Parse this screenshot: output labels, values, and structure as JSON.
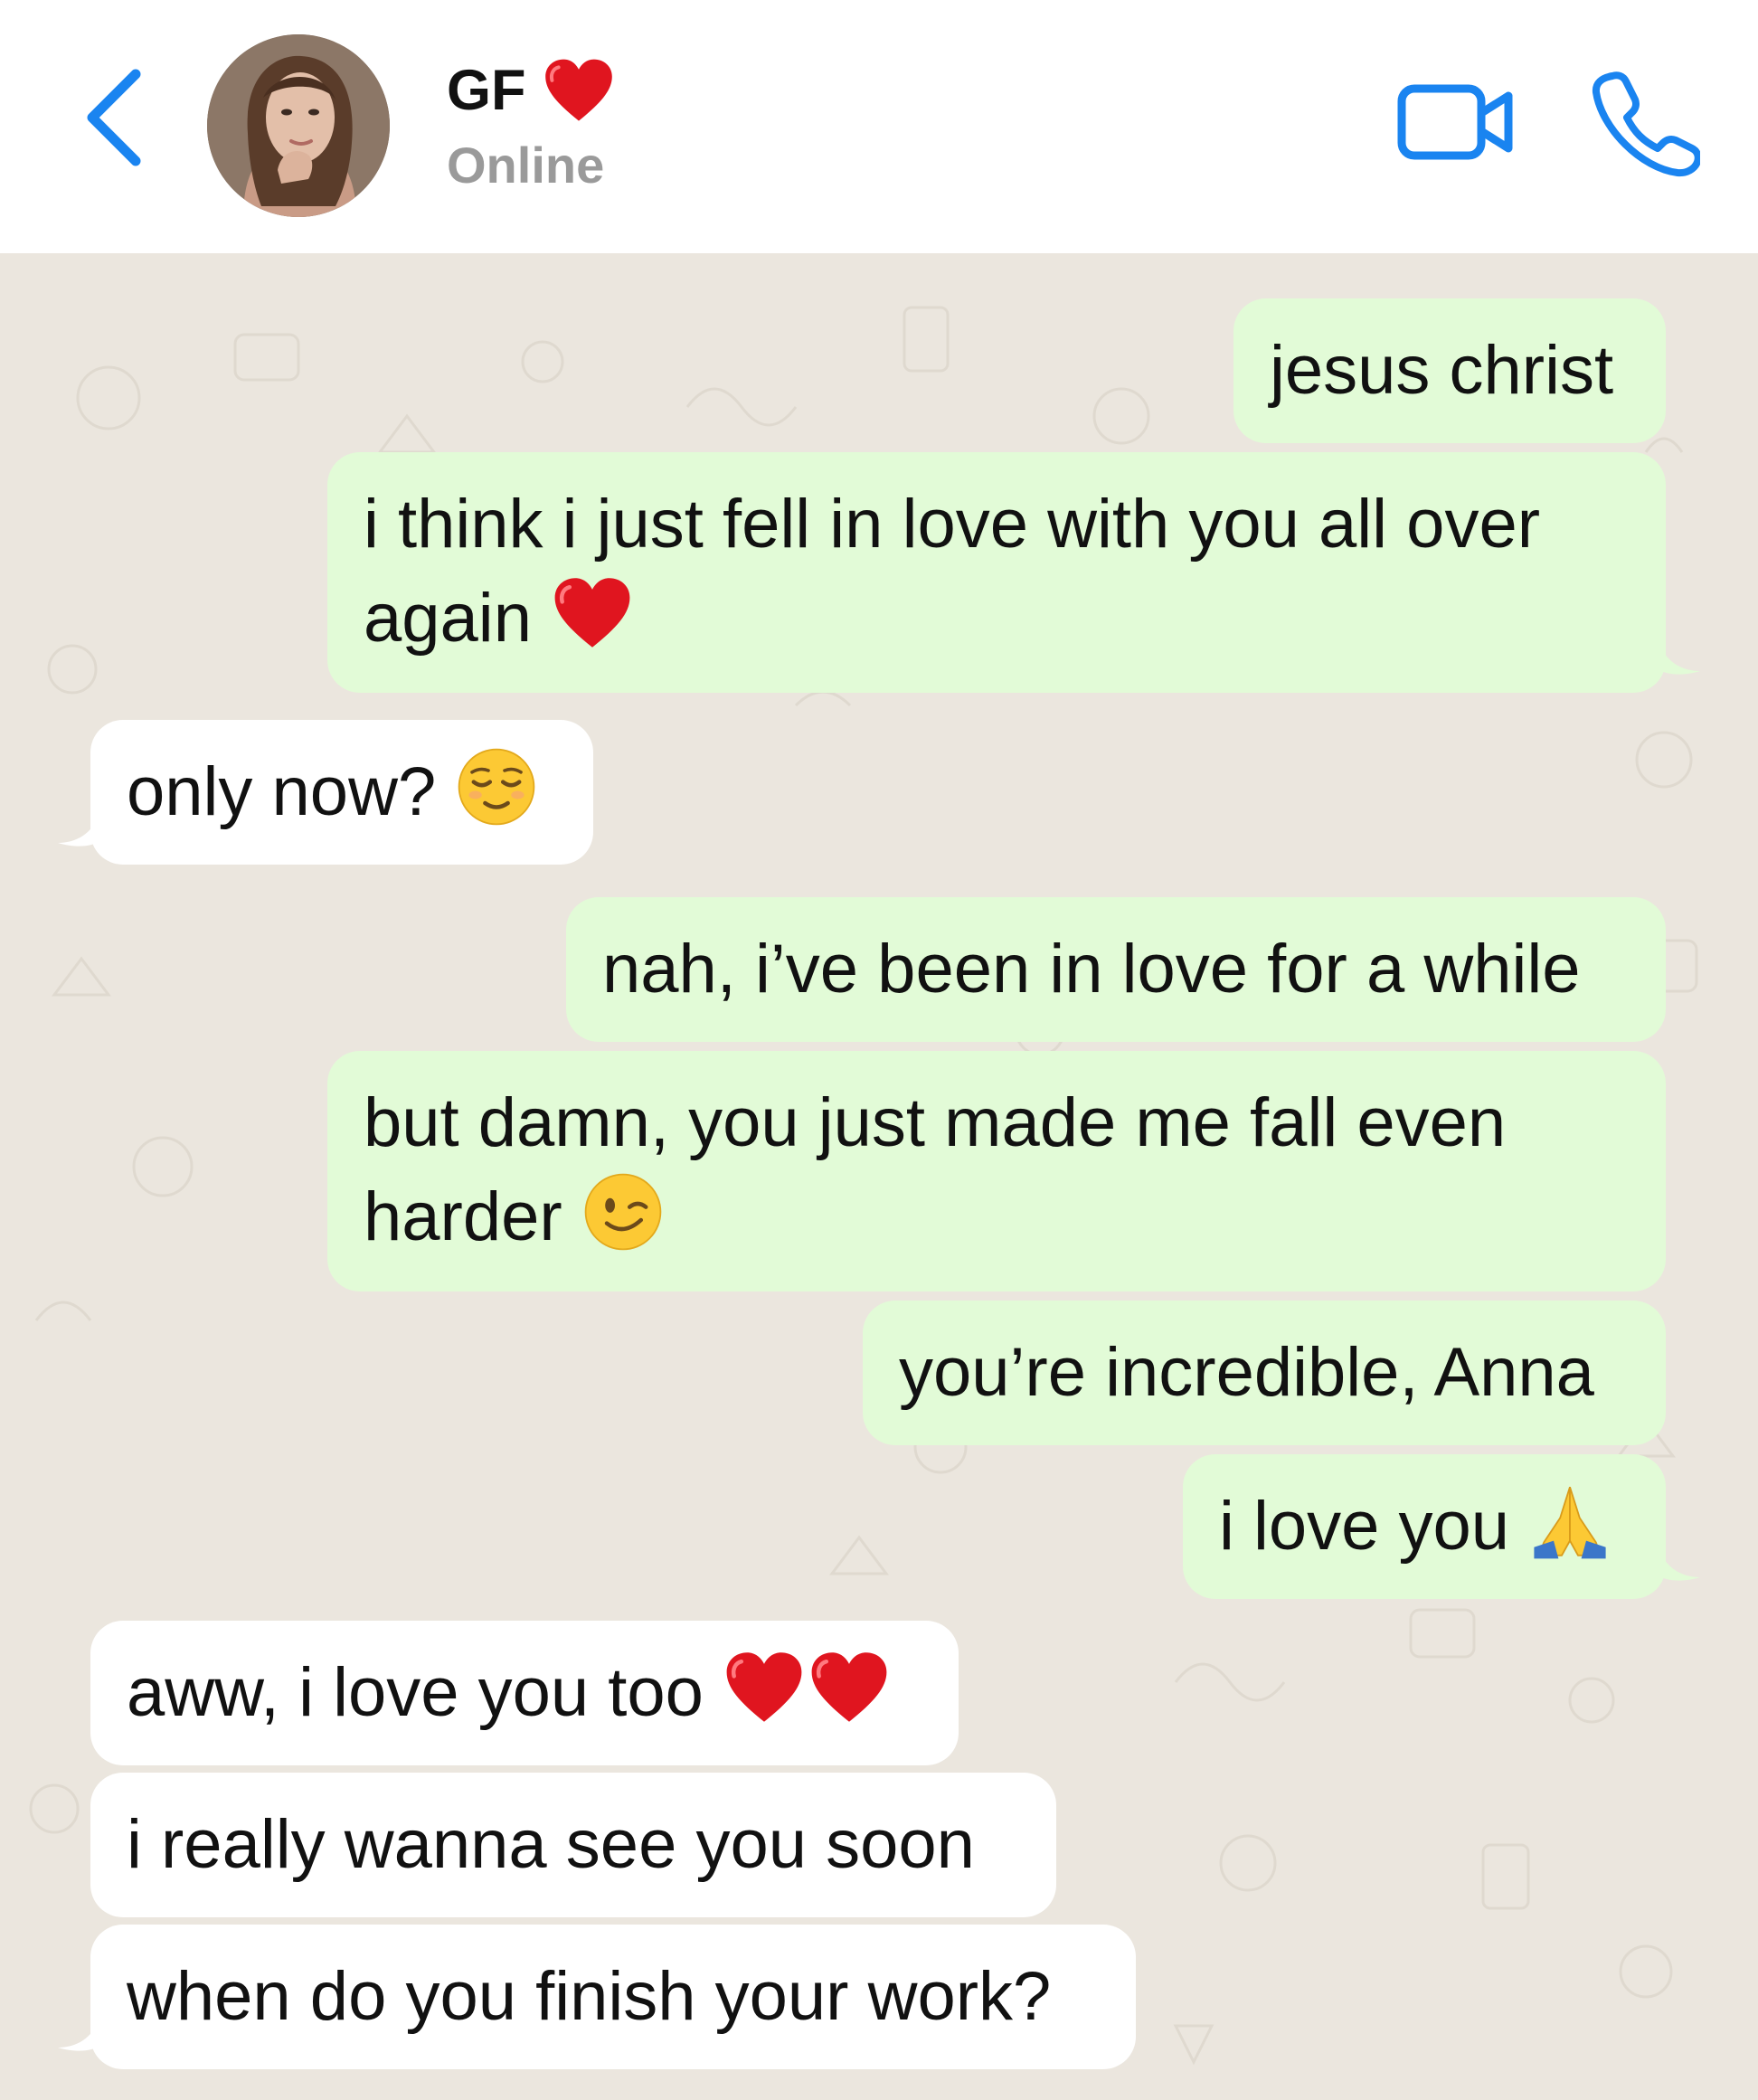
{
  "header": {
    "contact_name": "GF",
    "status": "Online",
    "accent_color": "#1a84f0"
  },
  "messages": [
    {
      "direction": "outgoing",
      "text": "jesus christ"
    },
    {
      "direction": "outgoing",
      "line1": "i think i just fell in love with you all over",
      "line2": "again",
      "emoji": "red-heart"
    },
    {
      "direction": "incoming",
      "text": "only now?",
      "emoji": "relieved-face"
    },
    {
      "direction": "outgoing",
      "text": "nah, i’ve been in love for a while"
    },
    {
      "direction": "outgoing",
      "line1": "but damn, you just made me fall even",
      "line2": "harder",
      "emoji": "winking-face"
    },
    {
      "direction": "outgoing",
      "text": "you’re incredible, Anna"
    },
    {
      "direction": "outgoing",
      "text": "i love you",
      "emoji": "folded-hands"
    },
    {
      "direction": "incoming",
      "text": "aww, i love you too",
      "emoji": "red-heart red-heart"
    },
    {
      "direction": "incoming",
      "text": "i really wanna see you soon"
    },
    {
      "direction": "incoming",
      "text": "when do you finish your work?"
    }
  ],
  "colors": {
    "outgoing_bubble": "#e2fbd7",
    "incoming_bubble": "#ffffff",
    "chat_background": "#ebe6de"
  }
}
